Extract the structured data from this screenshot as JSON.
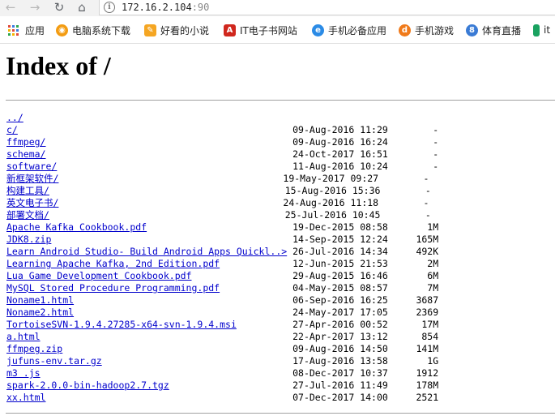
{
  "browser": {
    "nav": {
      "back_icon": "←",
      "forward_icon": "→",
      "reload_icon": "↻",
      "home_icon": "⌂"
    },
    "address": {
      "host": "172.16.2.104",
      "port": ":90"
    }
  },
  "bookmarks": [
    {
      "label": "应用",
      "icon": "apps-grid",
      "color": "#555555"
    },
    {
      "label": "电脑系统下载",
      "icon": "system-download-icon",
      "color": "#f39c12"
    },
    {
      "label": "好看的小说",
      "icon": "novel-icon",
      "color": "#f5a623"
    },
    {
      "label": "IT电子书网站",
      "icon": "pdf-icon",
      "color": "#d0271d"
    },
    {
      "label": "手机必备应用",
      "icon": "globe-icon",
      "color": "#2b8be6"
    },
    {
      "label": "手机游戏",
      "icon": "game-icon",
      "color": "#f07a1a"
    },
    {
      "label": "体育直播",
      "icon": "sports-icon",
      "color": "#3a7bd5"
    },
    {
      "label": "it",
      "icon": "leaf-icon",
      "color": "#1aa260"
    }
  ],
  "page": {
    "title": "Index of /",
    "entries": [
      {
        "name": "../",
        "date": "",
        "size": ""
      },
      {
        "name": "c/",
        "date": "09-Aug-2016 11:29",
        "size": "-"
      },
      {
        "name": "ffmpeg/",
        "date": "09-Aug-2016 16:24",
        "size": "-"
      },
      {
        "name": "schema/",
        "date": "24-Oct-2017 16:51",
        "size": "-"
      },
      {
        "name": "software/",
        "date": "11-Aug-2016 10:24",
        "size": "-"
      },
      {
        "name": "新框架软件/",
        "date": "19-May-2017 09:27",
        "size": "-"
      },
      {
        "name": "构建工具/",
        "date": "15-Aug-2016 15:36",
        "size": "-"
      },
      {
        "name": "英文电子书/",
        "date": "24-Aug-2016 11:18",
        "size": "-"
      },
      {
        "name": "部署文档/",
        "date": "25-Jul-2016 10:45",
        "size": "-"
      },
      {
        "name": "Apache Kafka Cookbook.pdf",
        "date": "19-Dec-2015 08:58",
        "size": "1M"
      },
      {
        "name": "JDK8.zip",
        "date": "14-Sep-2015 12:24",
        "size": "165M"
      },
      {
        "name": "Learn Android Studio- Build Android Apps Quickl..>",
        "date": "26-Jul-2016 14:34",
        "size": "492K"
      },
      {
        "name": "Learning Apache Kafka, 2nd Edition.pdf",
        "date": "12-Jun-2015 21:53",
        "size": "2M"
      },
      {
        "name": "Lua Game Development Cookbook.pdf",
        "date": "29-Aug-2015 16:46",
        "size": "6M"
      },
      {
        "name": "MySQL Stored Procedure Programming.pdf",
        "date": "04-May-2015 08:57",
        "size": "7M"
      },
      {
        "name": "Noname1.html",
        "date": "06-Sep-2016 16:25",
        "size": "3687"
      },
      {
        "name": "Noname2.html",
        "date": "24-May-2017 17:05",
        "size": "2369"
      },
      {
        "name": "TortoiseSVN-1.9.4.27285-x64-svn-1.9.4.msi",
        "date": "27-Apr-2016 00:52",
        "size": "17M"
      },
      {
        "name": "a.html",
        "date": "22-Apr-2017 13:12",
        "size": "854"
      },
      {
        "name": "ffmpeg.zip",
        "date": "09-Aug-2016 14:50",
        "size": "141M"
      },
      {
        "name": "jufuns-env.tar.gz",
        "date": "17-Aug-2016 13:58",
        "size": "1G"
      },
      {
        "name": "m3 .js",
        "date": "08-Dec-2017 10:37",
        "size": "1912"
      },
      {
        "name": "spark-2.0.0-bin-hadoop2.7.tgz",
        "date": "27-Jul-2016 11:49",
        "size": "178M"
      },
      {
        "name": "xx.html",
        "date": "07-Dec-2017 14:00",
        "size": "2521"
      }
    ]
  }
}
